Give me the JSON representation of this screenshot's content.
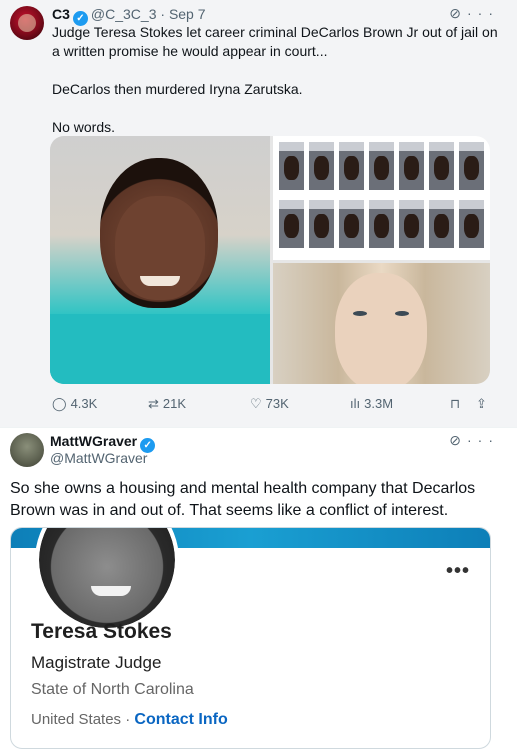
{
  "tweet1": {
    "name": "C3",
    "handle": "@C_3C_3",
    "date": "Sep 7",
    "paragraphs": [
      "Judge Teresa Stokes let career criminal DeCarlos Brown Jr out of jail on a written promise he would appear in court...",
      "DeCarlos then murdered Iryna Zarutska.",
      "No words."
    ],
    "stats": {
      "replies": "4.3K",
      "reposts": "21K",
      "likes": "73K",
      "views": "3.3M"
    },
    "icons": [
      "verified-badge",
      "grok-icon",
      "more-icon",
      "reply-icon",
      "repost-icon",
      "like-icon",
      "views-icon",
      "bookmark-icon",
      "share-icon"
    ]
  },
  "tweet2": {
    "name": "MattWGraver",
    "handle": "@MattWGraver",
    "text": "So she owns a housing and mental health company that Decarlos Brown was in and out of. That seems like a conflict of interest.",
    "card": {
      "name": "Teresa Stokes",
      "title": "Magistrate Judge",
      "organization": "State of North Carolina",
      "location": "United States",
      "separator": "·",
      "link": "Contact Info",
      "menu": "•••"
    }
  },
  "colors": {
    "accent": "#1d9bf0",
    "muted": "#536471",
    "link": "#0a66c2",
    "quoted_bg": "#f3f4f6"
  }
}
